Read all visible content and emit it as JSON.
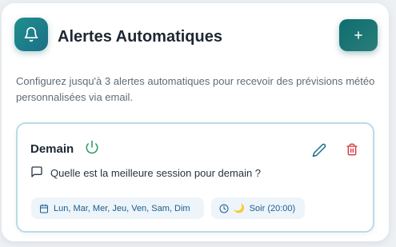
{
  "header": {
    "title": "Alertes Automatiques",
    "logo_icon": "bell-icon",
    "add_icon": "plus-icon",
    "description": "Configurez jusqu'à 3 alertes automatiques pour recevoir des prévisions météo personnalisées via email."
  },
  "alert": {
    "name": "Demain",
    "status_icon": "power-icon",
    "message": "Quelle est la meilleure session pour demain ?",
    "days": "Lun, Mar, Mer, Jeu, Ven, Sam, Dim",
    "time": "Soir (20:00)",
    "time_emoji": "🌙"
  },
  "colors": {
    "accent": "#1f7f84",
    "power": "#1e9a5a",
    "edit": "#1b6f8a",
    "delete": "#d3343b",
    "card_border": "#b9dbe6",
    "chip_bg": "#edf4fa",
    "chip_text": "#1b5d8c"
  }
}
